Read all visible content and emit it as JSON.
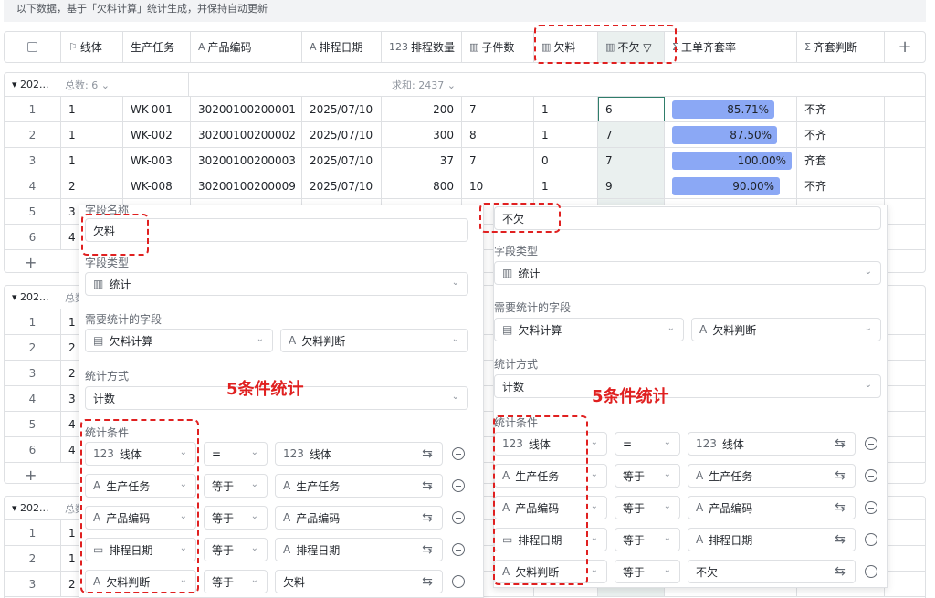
{
  "banner": "以下数据，基于「欠料计算」统计生成，并保持自动更新",
  "headers": [
    {
      "icon": "",
      "label": ""
    },
    {
      "icon": "⚐",
      "label": "线体"
    },
    {
      "icon": "",
      "label": "生产任务"
    },
    {
      "icon": "A",
      "label": "产品编码"
    },
    {
      "icon": "A",
      "label": "排程日期"
    },
    {
      "icon": "123",
      "label": "排程数量"
    },
    {
      "icon": "▥",
      "label": "子件数"
    },
    {
      "icon": "▥",
      "label": "欠料"
    },
    {
      "icon": "▥",
      "label": "不欠 ▽"
    },
    {
      "icon": "Σ",
      "label": "工单齐套率"
    },
    {
      "icon": "Σ",
      "label": "齐套判断"
    },
    {
      "icon": "",
      "label": "+"
    }
  ],
  "groups": [
    {
      "name": "▾ 202...",
      "count": "总数: 6 ⌄",
      "sum": "求和: 2437 ⌄"
    },
    {
      "name": "▾ 202...",
      "count": "总数"
    },
    {
      "name": "▾ 202...",
      "count": "总数"
    }
  ],
  "rows": [
    {
      "idx": "1",
      "line": "1",
      "task": "WK-001",
      "code": "30200100200001",
      "date": "2025/07/10",
      "qty": "200",
      "sub": "7",
      "short": "1",
      "ok": "6",
      "rate": "85.71%",
      "rate_val": 85.71,
      "judge": "不齐"
    },
    {
      "idx": "2",
      "line": "1",
      "task": "WK-002",
      "code": "30200100200002",
      "date": "2025/07/10",
      "qty": "300",
      "sub": "8",
      "short": "1",
      "ok": "7",
      "rate": "87.50%",
      "rate_val": 87.5,
      "judge": "不齐"
    },
    {
      "idx": "3",
      "line": "1",
      "task": "WK-003",
      "code": "30200100200003",
      "date": "2025/07/10",
      "qty": "37",
      "sub": "7",
      "short": "0",
      "ok": "7",
      "rate": "100.00%",
      "rate_val": 100,
      "judge": "齐套"
    },
    {
      "idx": "4",
      "line": "2",
      "task": "WK-008",
      "code": "30200100200009",
      "date": "2025/07/10",
      "qty": "800",
      "sub": "10",
      "short": "1",
      "ok": "9",
      "rate": "90.00%",
      "rate_val": 90,
      "judge": "不齐"
    },
    {
      "idx": "5",
      "line": "3"
    },
    {
      "idx": "6",
      "line": "4"
    }
  ],
  "group2_rows": [
    {
      "idx": "1",
      "line": "1"
    },
    {
      "idx": "2",
      "line": "2"
    },
    {
      "idx": "3",
      "line": "2"
    },
    {
      "idx": "4",
      "line": "3"
    },
    {
      "idx": "5",
      "line": "4"
    },
    {
      "idx": "6",
      "line": "4"
    }
  ],
  "group3_rows": [
    {
      "idx": "1",
      "line": "1"
    },
    {
      "idx": "2",
      "line": "1"
    },
    {
      "idx": "3",
      "line": "2"
    }
  ],
  "left_panel": {
    "field_name_label": "字段名称",
    "field_name": "欠料",
    "field_type_label": "字段类型",
    "field_type": "统计",
    "stat_field_label": "需要统计的字段",
    "stat_table": "欠料计算",
    "stat_field": "欠料判断",
    "method_label": "统计方式",
    "method": "计数",
    "cond_label": "统计条件",
    "conditions": [
      {
        "icon": "123",
        "field": "线体",
        "op": "=",
        "vicon": "123",
        "value": "线体"
      },
      {
        "icon": "A",
        "field": "生产任务",
        "op": "等于",
        "vicon": "A",
        "value": "生产任务"
      },
      {
        "icon": "A",
        "field": "产品编码",
        "op": "等于",
        "vicon": "A",
        "value": "产品编码"
      },
      {
        "icon": "▭",
        "field": "排程日期",
        "op": "等于",
        "vicon": "A",
        "value": "排程日期"
      },
      {
        "icon": "A",
        "field": "欠料判断",
        "op": "等于",
        "vicon": "",
        "value": "欠料"
      }
    ]
  },
  "right_panel": {
    "field_name": "不欠",
    "field_type_label": "字段类型",
    "field_type": "统计",
    "stat_field_label": "需要统计的字段",
    "stat_table": "欠料计算",
    "stat_field": "欠料判断",
    "method_label": "统计方式",
    "method": "计数",
    "cond_label": "统计条件",
    "conditions": [
      {
        "icon": "123",
        "field": "线体",
        "op": "=",
        "vicon": "123",
        "value": "线体"
      },
      {
        "icon": "A",
        "field": "生产任务",
        "op": "等于",
        "vicon": "A",
        "value": "生产任务"
      },
      {
        "icon": "A",
        "field": "产品编码",
        "op": "等于",
        "vicon": "A",
        "value": "产品编码"
      },
      {
        "icon": "▭",
        "field": "排程日期",
        "op": "等于",
        "vicon": "A",
        "value": "排程日期"
      },
      {
        "icon": "A",
        "field": "欠料判断",
        "op": "等于",
        "vicon": "",
        "value": "不欠"
      }
    ]
  },
  "annotation_left": "5条件统计",
  "annotation_right": "5条件统计",
  "colors": {
    "bar": "#8ba8f5",
    "annotation": "#e02020",
    "selected_col": "#eaf0ef"
  }
}
